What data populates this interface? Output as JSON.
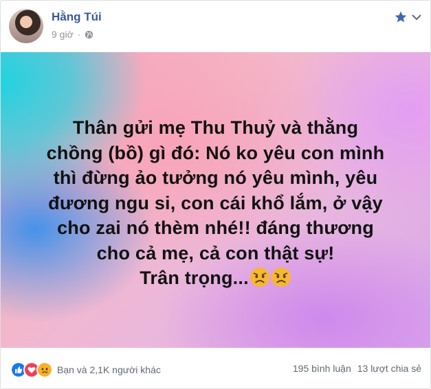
{
  "post": {
    "author_name": "Hằng Túi",
    "time": "9 giờ",
    "privacy_icon": "globe-icon",
    "message_lines": [
      "Thân gửi mẹ Thu Thuỷ và thằng",
      "chồng (bồ) gì đó: Nó ko yêu con mình",
      "thì đừng ảo tưởng nó yêu mình, yêu",
      "đương ngu si, con cái khổ lắm, ở vậy",
      "cho zai nó thèm nhé!! đáng thương",
      "cho cả mẹ, cả con thật sự!",
      "Trân trọng..."
    ],
    "trailing_emojis": [
      "frowning-face-emoji",
      "frowning-face-emoji"
    ]
  },
  "footer": {
    "reactions_text": "Bạn và 2,1K người khác",
    "reaction_icons": [
      "like-reaction-icon",
      "love-reaction-icon",
      "sad-reaction-icon"
    ],
    "comments": "195 bình luận",
    "shares": "13 lượt chia sẻ"
  },
  "colors": {
    "name": "#385898",
    "meta": "#90949c",
    "like": "#1877f2",
    "love": "#f33e58",
    "sad": "#f7b125"
  }
}
